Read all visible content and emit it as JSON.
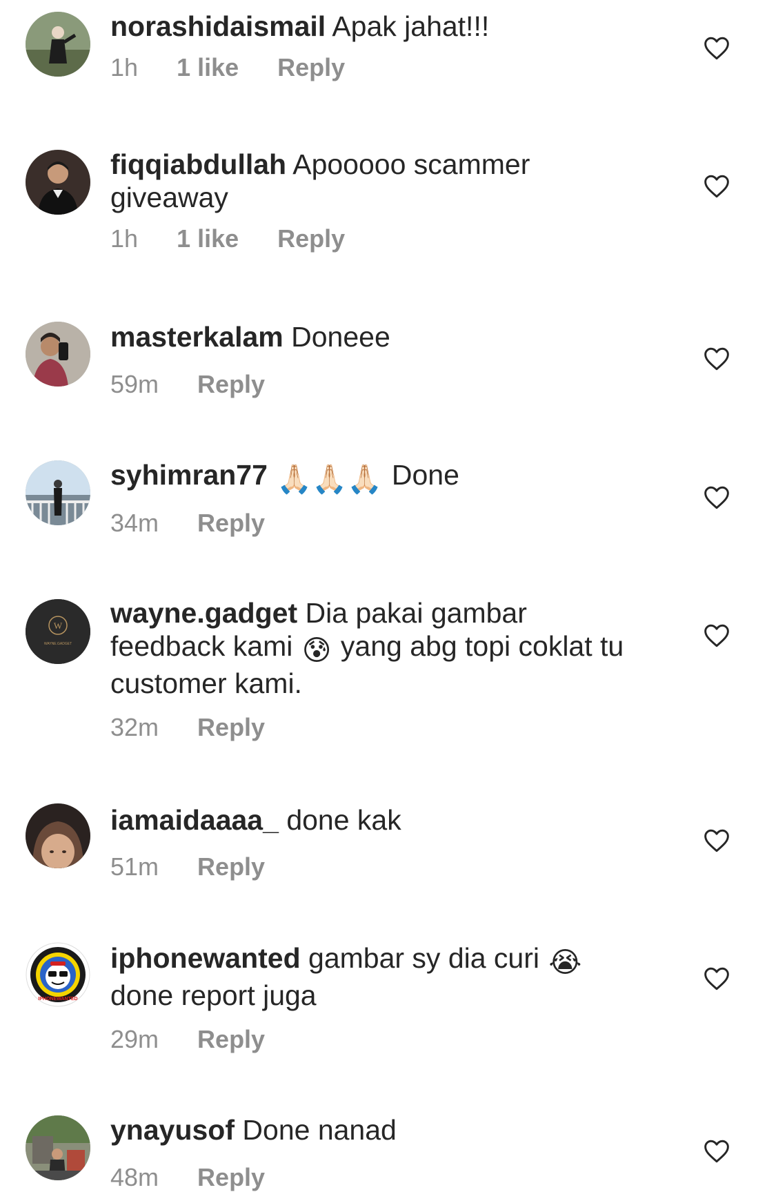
{
  "comments": [
    {
      "username": "norashidaismail",
      "text": "Apak jahat!!!",
      "time": "1h",
      "likes": "1 like",
      "reply": "Reply"
    },
    {
      "username": "fiqqiabdullah",
      "text": "Apooooo scammer giveaway",
      "time": "1h",
      "likes": "1 like",
      "reply": "Reply"
    },
    {
      "username": "masterkalam",
      "text": "Doneee",
      "time": "59m",
      "reply": "Reply"
    },
    {
      "username": "syhimran77",
      "text_emoji": "🙏🏻🙏🏻🙏🏻",
      "text": "Done",
      "time": "34m",
      "reply": "Reply"
    },
    {
      "username": "wayne.gadget",
      "text_before": "Dia pakai gambar feedback kami",
      "text_emoji": "😰",
      "text_after": "yang abg topi coklat tu customer kami.",
      "time": "32m",
      "reply": "Reply",
      "avatar_label": "WAYNE.GADGET"
    },
    {
      "username": "iamaidaaaa_",
      "text": "done kak",
      "time": "51m",
      "reply": "Reply"
    },
    {
      "username": "iphonewanted",
      "text_before": "gambar sy dia curi",
      "text_emoji": "😭",
      "text_after": "done report juga",
      "time": "29m",
      "reply": "Reply",
      "avatar_label": "IPHONEWANTED"
    },
    {
      "username": "ynayusof",
      "text": "Done nanad",
      "time": "48m",
      "reply": "Reply"
    }
  ],
  "icons": {
    "like": "heart-outline-icon"
  },
  "colors": {
    "text": "#262626",
    "meta": "#8e8e8e",
    "background": "#ffffff"
  }
}
